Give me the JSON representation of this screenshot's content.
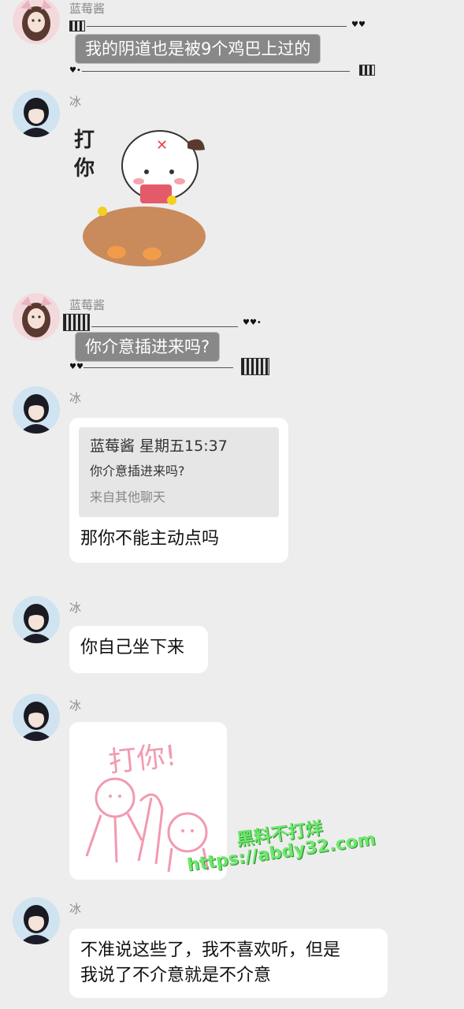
{
  "messages": [
    {
      "sender": "蓝莓酱",
      "text": "我的阴道也是被9个鸡巴上过的"
    },
    {
      "sender": "冰",
      "sticker_text": "打你"
    },
    {
      "sender": "蓝莓酱",
      "text": "你介意插进来吗?"
    },
    {
      "sender": "冰",
      "quote": {
        "header": "蓝莓酱 星期五15:37",
        "text": "你介意插进来吗?",
        "source": "来自其他聊天"
      },
      "text": "那你不能主动点吗"
    },
    {
      "sender": "冰",
      "text": "你自己坐下来"
    },
    {
      "sender": "冰",
      "sticker_text": "打你!"
    },
    {
      "sender": "冰",
      "text_lines": [
        "不准说这些了，我不喜欢听，但是",
        "我说了不介意就是不介意"
      ]
    }
  ],
  "watermark": {
    "line1": "黑料不打烊",
    "line2": "https://abdy32.com"
  },
  "colors": {
    "background": "#ededed",
    "bubble": "#ffffff",
    "watermark": "#6ee86e"
  }
}
